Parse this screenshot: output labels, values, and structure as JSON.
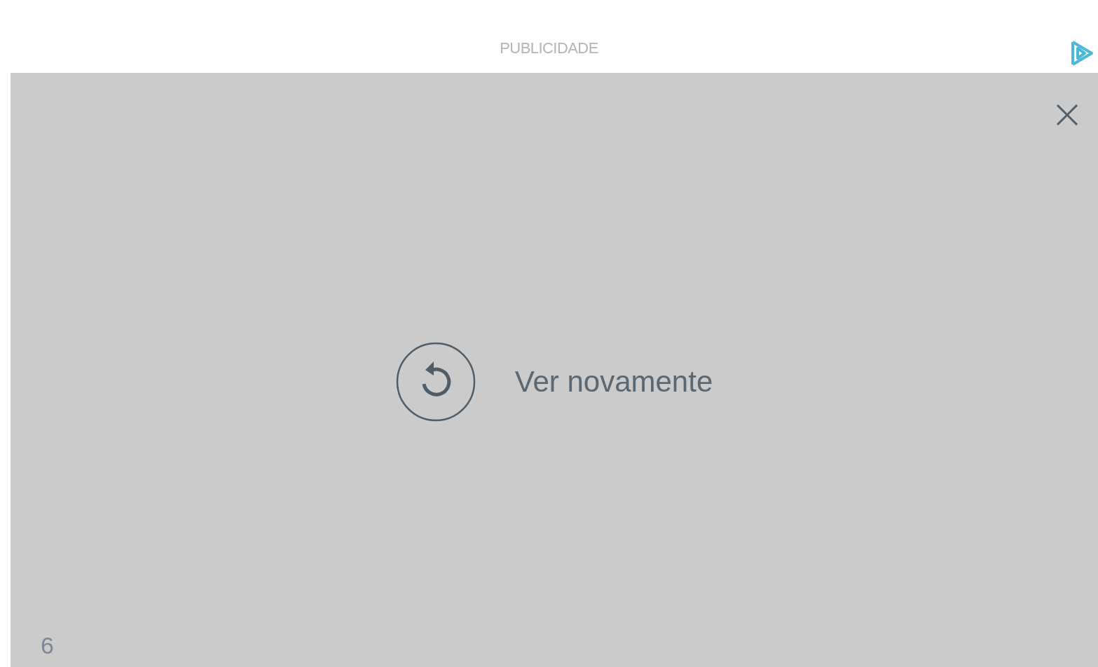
{
  "header": {
    "label": "PUBLICIDADE"
  },
  "ad": {
    "replay_label": "Ver novamente",
    "counter": "6"
  }
}
